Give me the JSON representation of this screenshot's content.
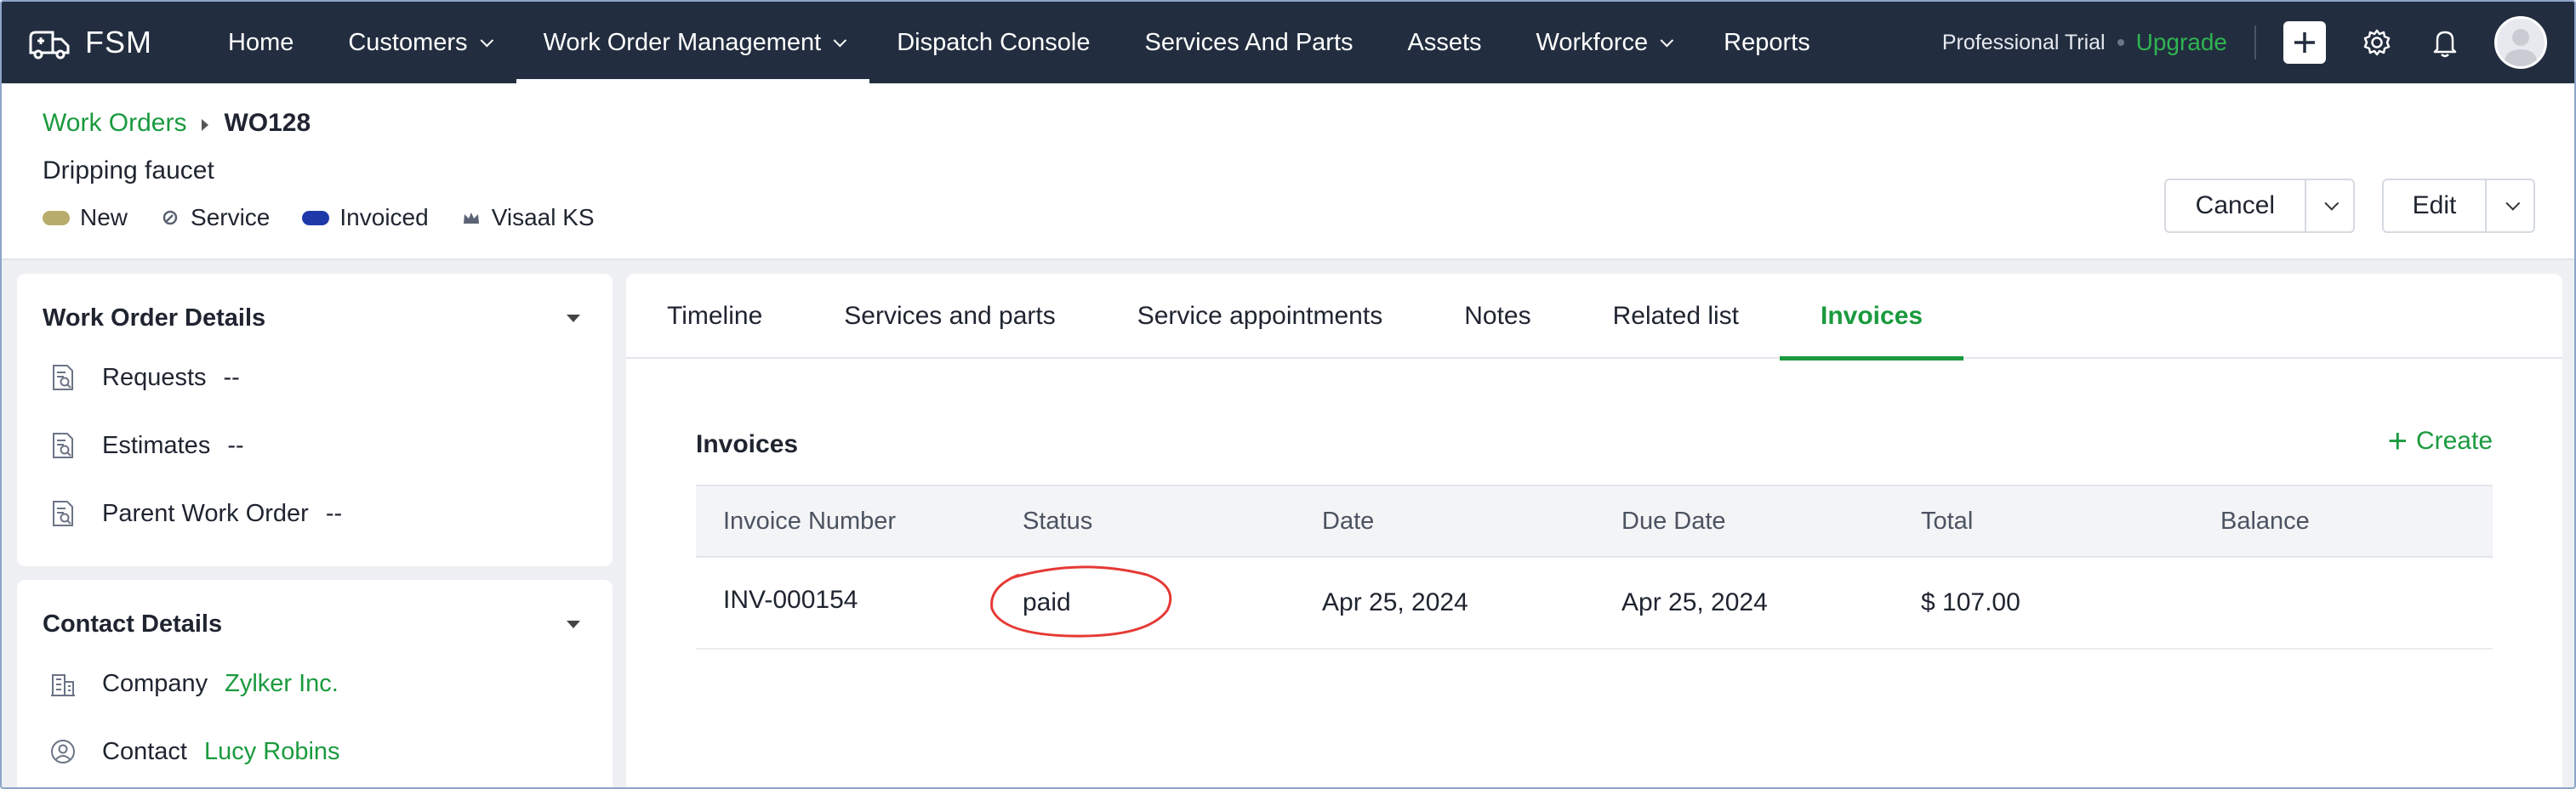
{
  "nav": {
    "brand": "FSM",
    "items": [
      {
        "label": "Home",
        "dropdown": false,
        "active": false
      },
      {
        "label": "Customers",
        "dropdown": true,
        "active": false
      },
      {
        "label": "Work Order Management",
        "dropdown": true,
        "active": true
      },
      {
        "label": "Dispatch Console",
        "dropdown": false,
        "active": false
      },
      {
        "label": "Services And Parts",
        "dropdown": false,
        "active": false
      },
      {
        "label": "Assets",
        "dropdown": false,
        "active": false
      },
      {
        "label": "Workforce",
        "dropdown": true,
        "active": false
      },
      {
        "label": "Reports",
        "dropdown": false,
        "active": false
      }
    ],
    "trial_label": "Professional Trial",
    "upgrade_label": "Upgrade"
  },
  "header": {
    "breadcrumb_parent": "Work Orders",
    "breadcrumb_current": "WO128",
    "subtitle": "Dripping faucet",
    "tags": {
      "status": "New",
      "type": "Service",
      "billing": "Invoiced",
      "owner": "Visaal KS"
    },
    "cancel_label": "Cancel",
    "edit_label": "Edit"
  },
  "work_order_details": {
    "title": "Work Order Details",
    "rows": [
      {
        "label": "Requests",
        "value": "--"
      },
      {
        "label": "Estimates",
        "value": "--"
      },
      {
        "label": "Parent Work Order",
        "value": "--"
      }
    ]
  },
  "contact_details": {
    "title": "Contact Details",
    "rows": [
      {
        "label": "Company",
        "value": "Zylker Inc."
      },
      {
        "label": "Contact",
        "value": "Lucy Robins"
      }
    ]
  },
  "tabs": [
    {
      "label": "Timeline",
      "active": false
    },
    {
      "label": "Services and parts",
      "active": false
    },
    {
      "label": "Service appointments",
      "active": false
    },
    {
      "label": "Notes",
      "active": false
    },
    {
      "label": "Related list",
      "active": false
    },
    {
      "label": "Invoices",
      "active": true
    }
  ],
  "invoices": {
    "title": "Invoices",
    "create_label": "Create",
    "columns": [
      "Invoice Number",
      "Status",
      "Date",
      "Due Date",
      "Total",
      "Balance"
    ],
    "rows": [
      [
        "INV-000154",
        "paid",
        "Apr 25, 2024",
        "Apr 25, 2024",
        "$ 107.00",
        ""
      ]
    ]
  },
  "colors": {
    "nav_bg": "#222d3f",
    "accent_green": "#1a9a3e",
    "tag_new": "#b8ac6c",
    "tag_invoiced": "#1e3aa8",
    "annotation_red": "#e53935"
  }
}
